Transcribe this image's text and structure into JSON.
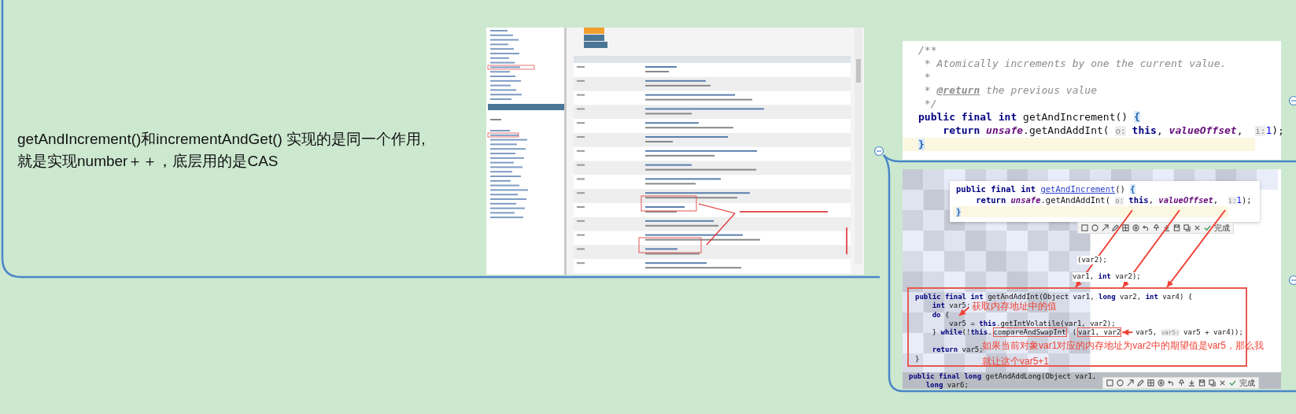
{
  "mind_map": {
    "root_topic": {
      "lines": [
        "getAndIncrement()和incrementAndGet() 实现的是同一个作用,",
        "就是实现number＋＋，底层用的是CAS"
      ]
    },
    "images": [
      {
        "kind": "doc_screenshot"
      },
      {
        "kind": "code_screenshot",
        "lines": [
          {
            "tokens": [
              {
                "text": "/**",
                "kind": "comment"
              }
            ],
            "highlighted": false
          },
          {
            "tokens": [
              {
                "text": " * Atomically increments by one the current value.",
                "kind": "comment"
              }
            ],
            "highlighted": false
          },
          {
            "tokens": [
              {
                "text": " *",
                "kind": "comment"
              }
            ],
            "highlighted": false
          },
          {
            "tokens": [
              {
                "text": " * ",
                "kind": "comment"
              },
              {
                "text": "@return",
                "kind": "doctag"
              },
              {
                "text": " the previous value",
                "kind": "comment"
              }
            ],
            "highlighted": false
          },
          {
            "tokens": [
              {
                "text": " */",
                "kind": "comment"
              }
            ],
            "highlighted": false
          },
          {
            "tokens": [
              {
                "text": "public final int ",
                "kind": "kw"
              },
              {
                "text": "getAndIncrement() ",
                "kind": "plain"
              },
              {
                "text": "{",
                "kind": "brace"
              }
            ],
            "highlighted": false
          },
          {
            "tokens": [
              {
                "text": "    return ",
                "kind": "kw"
              },
              {
                "text": "unsafe",
                "kind": "field"
              },
              {
                "text": ".getAndAddInt( ",
                "kind": "plain"
              },
              {
                "text": "o:",
                "kind": "hint"
              },
              {
                "text": " this",
                "kind": "kw"
              },
              {
                "text": ", ",
                "kind": "plain"
              },
              {
                "text": "valueOffset",
                "kind": "field"
              },
              {
                "text": ",  ",
                "kind": "plain"
              },
              {
                "text": "i:",
                "kind": "hint"
              },
              {
                "text": "1",
                "kind": "num"
              },
              {
                "text": ");",
                "kind": "plain"
              }
            ],
            "highlighted": false
          },
          {
            "tokens": [
              {
                "text": "}",
                "kind": "brace"
              }
            ],
            "highlighted": true
          }
        ]
      },
      {
        "kind": "annotated_screenshot",
        "popup_lines": [
          {
            "tokens": [
              {
                "text": "public final int ",
                "kind": "kw"
              },
              {
                "text": "getAndIncrement",
                "kind": "link"
              },
              {
                "text": "() ",
                "kind": "plain"
              },
              {
                "text": "{",
                "kind": "brace"
              }
            ],
            "highlighted": false
          },
          {
            "tokens": [
              {
                "text": "    return ",
                "kind": "kw"
              },
              {
                "text": "unsafe",
                "kind": "field"
              },
              {
                "text": ".getAndAddInt( ",
                "kind": "plain"
              },
              {
                "text": "o:",
                "kind": "hint"
              },
              {
                "text": " this",
                "kind": "kw"
              },
              {
                "text": ", ",
                "kind": "plain"
              },
              {
                "text": "valueOffset",
                "kind": "field"
              },
              {
                "text": ",  ",
                "kind": "plain"
              },
              {
                "text": "i:",
                "kind": "hint"
              },
              {
                "text": "1",
                "kind": "num"
              },
              {
                "text": ");",
                "kind": "plain"
              }
            ],
            "highlighted": false
          },
          {
            "tokens": [
              {
                "text": "}",
                "kind": "brace"
              }
            ],
            "highlighted": true
          }
        ],
        "background_fragments": [
          {
            "tokens": [
              {
                "text": "(var2);",
                "kind": "plain"
              }
            ],
            "highlighted": false
          },
          {
            "tokens": [
              {
                "text": "var1, ",
                "kind": "plain"
              },
              {
                "text": "int ",
                "kind": "kw"
              },
              {
                "text": "var2);",
                "kind": "plain"
              }
            ],
            "highlighted": false
          }
        ],
        "boxed_code": [
          {
            "tokens": [
              {
                "text": "public final int ",
                "kind": "kw"
              },
              {
                "text": "getAndAddInt(Object var1, ",
                "kind": "plain"
              },
              {
                "text": "long ",
                "kind": "kw"
              },
              {
                "text": "var2, ",
                "kind": "plain"
              },
              {
                "text": "int ",
                "kind": "kw"
              },
              {
                "text": "var4) {",
                "kind": "plain"
              }
            ],
            "highlighted": false
          },
          {
            "tokens": [
              {
                "text": "    int ",
                "kind": "kw"
              },
              {
                "text": "var5;",
                "kind": "plain"
              }
            ],
            "highlighted": false
          },
          {
            "tokens": [
              {
                "text": "    do ",
                "kind": "kw"
              },
              {
                "text": "{",
                "kind": "plain"
              }
            ],
            "highlighted": false
          },
          {
            "tokens": [
              {
                "text": "        var5 = ",
                "kind": "plain"
              },
              {
                "text": "this",
                "kind": "kw"
              },
              {
                "text": ".getIntVolatile(var1, var2);",
                "kind": "plain"
              }
            ],
            "highlighted": false
          },
          {
            "tokens": [
              {
                "text": "    } ",
                "kind": "plain"
              },
              {
                "text": "while",
                "kind": "kw"
              },
              {
                "text": "(!",
                "kind": "plain"
              },
              {
                "text": "this",
                "kind": "kw"
              },
              {
                "text": ".",
                "kind": "plain"
              },
              {
                "text": "compareAndSwapInt",
                "kind": "boxed"
              },
              {
                "text": "(",
                "kind": "plain"
              },
              {
                "text": "var1, var2",
                "kind": "boxed"
              },
              {
                "text": "  var5, ",
                "kind": "plain"
              },
              {
                "text": "var5:",
                "kind": "hint"
              },
              {
                "text": " var5 + var4));",
                "kind": "plain"
              }
            ],
            "highlighted": false
          },
          {
            "tokens": [
              {
                "text": "    return ",
                "kind": "kw"
              },
              {
                "text": "var5;",
                "kind": "plain"
              }
            ],
            "highlighted": false,
            "gap_before": true
          },
          {
            "tokens": [
              {
                "text": "}",
                "kind": "plain"
              }
            ]
          }
        ],
        "annotations": [
          "获取内存地址中的值",
          "如果当前对象var1对应的内存地址为var2中的期望值是var5，那么我就让这个var5+1"
        ],
        "covered_lines": [
          {
            "tokens": [
              {
                "text": "public final long ",
                "kind": "kw"
              },
              {
                "text": "getAndAddLong(Object var1,",
                "kind": "plain"
              }
            ],
            "highlighted": false
          },
          {
            "tokens": [
              {
                "text": "    long ",
                "kind": "kw"
              },
              {
                "text": "var6;",
                "kind": "plain"
              }
            ],
            "highlighted": false
          }
        ],
        "toolbars": [
          {
            "confirm_label": "完成"
          },
          {
            "confirm_label": "完成"
          }
        ]
      }
    ]
  }
}
